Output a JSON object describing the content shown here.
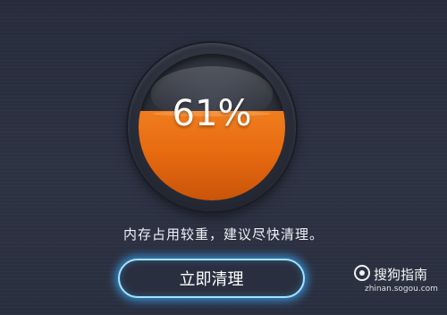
{
  "gauge": {
    "percent_label": "61%",
    "fill_fraction": 0.61,
    "fill_color": "#e86b10"
  },
  "message": "内存占用较重，建议尽快清理。",
  "clean_button": {
    "label": "立即清理",
    "glow_color": "#3caaff"
  },
  "watermark": {
    "name": "搜狗指南",
    "url": "zhinan.sogou.com"
  }
}
